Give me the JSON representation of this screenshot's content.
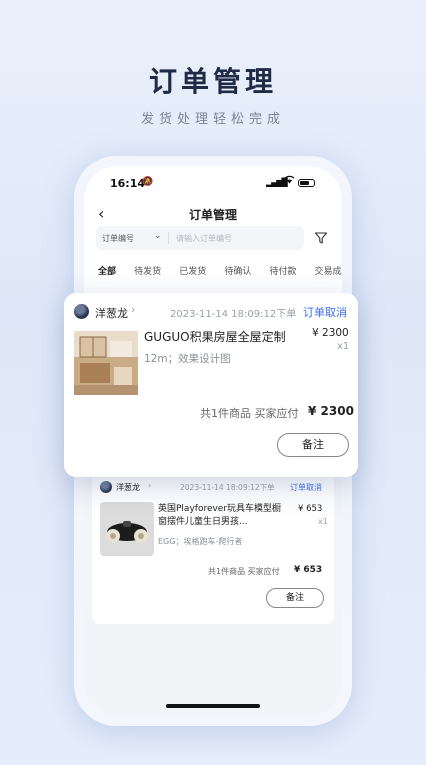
{
  "hero": {
    "title": "订单管理",
    "subtitle": "发货处理轻松完成"
  },
  "status_bar": {
    "time": "16:14"
  },
  "nav": {
    "back_icon": "‹",
    "title": "订单管理"
  },
  "search": {
    "type_label": "订单编号",
    "placeholder": "请输入订单编号"
  },
  "tabs": [
    {
      "label": "全部",
      "active": true
    },
    {
      "label": "待发货"
    },
    {
      "label": "已发货"
    },
    {
      "label": "待确认"
    },
    {
      "label": "待付款"
    },
    {
      "label": "交易成"
    }
  ],
  "orders": [
    {
      "buyer": "洋葱龙",
      "datetime": "2023-11-14 18:09:12下单",
      "status": "订单取消",
      "title": "GUGUO积果房屋全屋定制",
      "spec": "12m；效果设计图",
      "price": "¥ 2300",
      "qty": "x1",
      "summary": "共1件商品  买家应付",
      "total": "¥ 2300",
      "note_button": "备注"
    },
    {
      "buyer": "洋葱龙",
      "datetime": "2023-11-14 18:09:12下单",
      "status": "订单取消",
      "title": "英国Playforever玩具车模型橱窗摆件儿童生日男孩...",
      "spec": "EGG；埃格跑车-爬行者",
      "price": "¥ 653",
      "qty": "x1",
      "summary": "共1件商品  买家应付",
      "total": "¥ 653",
      "note_button": "备注"
    }
  ]
}
